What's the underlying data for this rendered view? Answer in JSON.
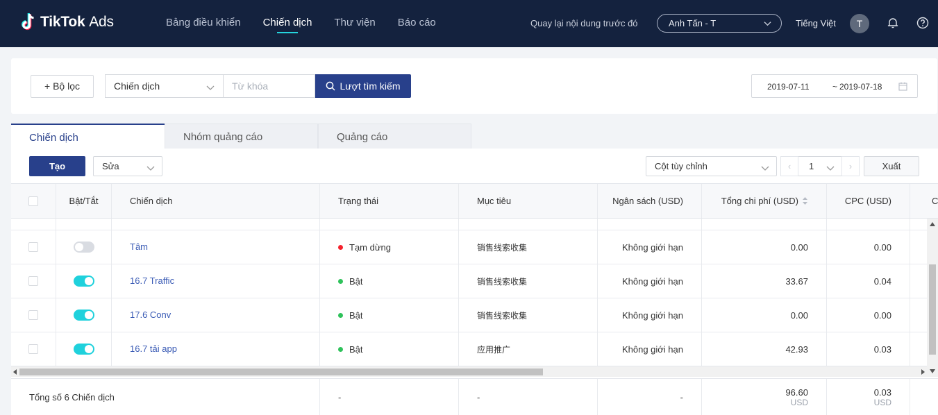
{
  "brand": {
    "name_bold": "TikTok",
    "name_light": "Ads"
  },
  "nav": [
    {
      "label": "Bảng điều khiển",
      "active": false
    },
    {
      "label": "Chiến dịch",
      "active": true
    },
    {
      "label": "Thư viện",
      "active": false
    },
    {
      "label": "Báo cáo",
      "active": false
    }
  ],
  "header": {
    "back_link": "Quay lại nội dung trước đó",
    "account": "Anh Tấn - T",
    "language": "Tiếng Việt",
    "avatar_initial": "T",
    "icons": [
      "bell-icon",
      "help-icon"
    ]
  },
  "filter": {
    "filter_button": "Bộ lọc",
    "search_type": "Chiến dịch",
    "search_placeholder": "Từ khóa",
    "search_button": "Lượt tìm kiếm",
    "date_start": "2019-07-11",
    "date_sep": "~",
    "date_end": "2019-07-18"
  },
  "tabs": [
    {
      "label": "Chiến dịch",
      "active": true
    },
    {
      "label": "Nhóm quảng cáo",
      "active": false
    },
    {
      "label": "Quảng cáo",
      "active": false
    }
  ],
  "toolbar": {
    "create_button": "Tạo",
    "edit_select": "Sửa",
    "columns_select": "Cột tùy chỉnh",
    "page": "1",
    "export_button": "Xuất"
  },
  "table": {
    "headers": {
      "toggle": "Bật/Tắt",
      "campaign": "Chiến dịch",
      "status": "Trạng thái",
      "objective": "Mục tiêu",
      "budget": "Ngân sách (USD)",
      "total_cost": "Tổng chi phí (USD)",
      "cpc": "CPC (USD)",
      "next": "C"
    },
    "rows": [
      {
        "name": "Tâm",
        "on": false,
        "status": "Tạm dừng",
        "status_color": "#f5222d",
        "objective": "销售线索收集",
        "budget": "Không giới hạn",
        "total_cost": "0.00",
        "cpc": "0.00"
      },
      {
        "name": "16.7 Traffic",
        "on": true,
        "status": "Bật",
        "status_color": "#2fc25b",
        "objective": "销售线索收集",
        "budget": "Không giới hạn",
        "total_cost": "33.67",
        "cpc": "0.04"
      },
      {
        "name": "17.6 Conv",
        "on": true,
        "status": "Bật",
        "status_color": "#2fc25b",
        "objective": "销售线索收集",
        "budget": "Không giới hạn",
        "total_cost": "0.00",
        "cpc": "0.00"
      },
      {
        "name": "16.7 tải app",
        "on": true,
        "status": "Bật",
        "status_color": "#2fc25b",
        "objective": "应用推广",
        "budget": "Không giới hạn",
        "total_cost": "42.93",
        "cpc": "0.03"
      }
    ],
    "footer": {
      "summary": "Tổng số 6 Chiến dịch",
      "status": "-",
      "objective": "-",
      "budget": "-",
      "total_cost": "96.60",
      "total_cost_unit": "USD",
      "cpc": "0.03",
      "cpc_unit": "USD"
    }
  },
  "colors": {
    "topbar": "#14223e",
    "primary": "#28408b",
    "accent": "#25d4de",
    "toggle_on": "#1fd1dc"
  }
}
